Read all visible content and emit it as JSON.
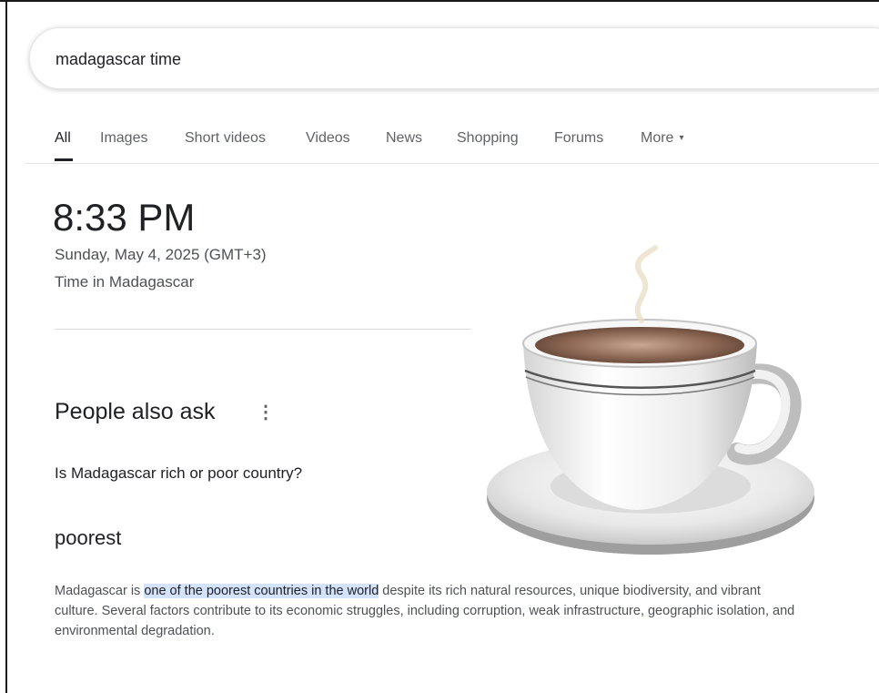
{
  "search": {
    "query": "madagascar time"
  },
  "tabs": [
    {
      "label": "All"
    },
    {
      "label": "Images"
    },
    {
      "label": "Short videos"
    },
    {
      "label": "Videos"
    },
    {
      "label": "News"
    },
    {
      "label": "Shopping"
    },
    {
      "label": "Forums"
    },
    {
      "label": "More"
    }
  ],
  "clock": {
    "time": "8:33 PM",
    "date": "Sunday, May 4, 2025 (GMT+3)",
    "place": "Time in Madagascar"
  },
  "people_also_ask": {
    "title": "People also ask",
    "menu_icon": "⋮",
    "question": "Is Madagascar rich or poor country?",
    "answer": "poorest",
    "snippet_before": "Madagascar is ",
    "snippet_highlight": "one of the poorest countries in the world",
    "snippet_after": " despite its rich natural resources, unique biodiversity, and vibrant culture. Several factors contribute to its economic struggles, including corruption, weak infrastructure, geographic isolation, and environmental degradation."
  },
  "colors": {
    "highlight": "#d3e3fd",
    "coffee": "#6b4a3a"
  },
  "icons": {
    "more_caret": "chevron-down-icon",
    "paa_menu": "more-vertical-icon",
    "cup": "coffee-cup-icon"
  }
}
